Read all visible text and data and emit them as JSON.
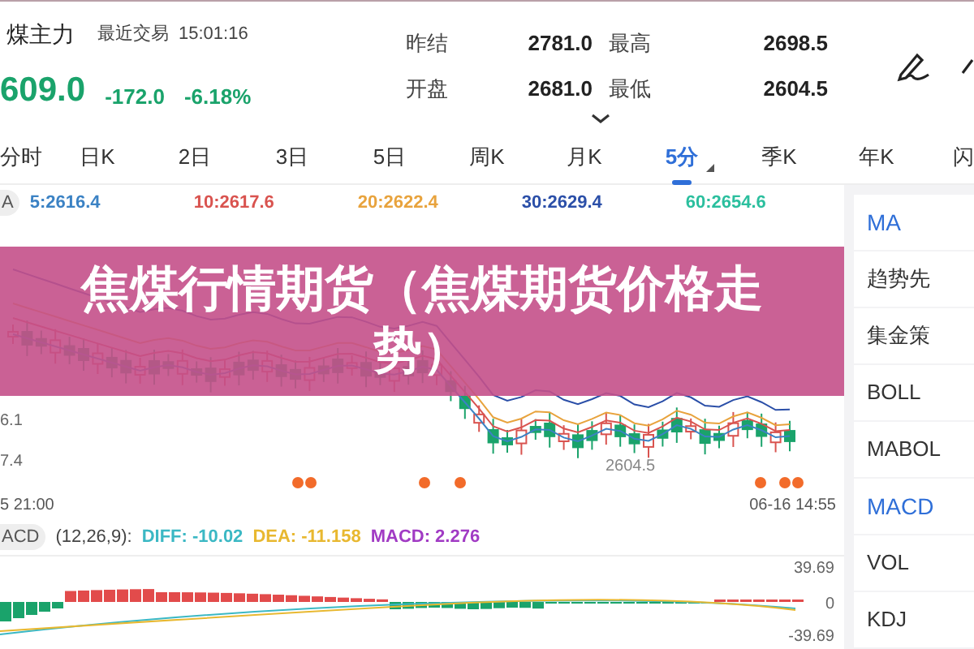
{
  "header": {
    "name": "煤主力",
    "trade_label": "最近交易",
    "trade_time": "15:01:16",
    "price": "609.0",
    "change": "-172.0",
    "change_pct": "-6.18%",
    "stats": [
      {
        "label": "昨结",
        "value": "2781.0"
      },
      {
        "label": "最高",
        "value": "2698.5"
      },
      {
        "label": "开盘",
        "value": "2681.0"
      },
      {
        "label": "最低",
        "value": "2604.5"
      }
    ]
  },
  "tabs": [
    {
      "label": "分时",
      "selected": false
    },
    {
      "label": "日K",
      "selected": false
    },
    {
      "label": "2日",
      "selected": false
    },
    {
      "label": "3日",
      "selected": false
    },
    {
      "label": "5日",
      "selected": false
    },
    {
      "label": "周K",
      "selected": false
    },
    {
      "label": "月K",
      "selected": false
    },
    {
      "label": "5分",
      "selected": true
    },
    {
      "label": "季K",
      "selected": false
    },
    {
      "label": "年K",
      "selected": false
    },
    {
      "label": "闪",
      "selected": false
    }
  ],
  "ma_legend": {
    "badge": "A",
    "items": [
      {
        "text": "5:2616.4",
        "color": "#3b82c4"
      },
      {
        "text": "10:2617.6",
        "color": "#d9534f"
      },
      {
        "text": "20:2622.4",
        "color": "#e8a33d"
      },
      {
        "text": "30:2629.4",
        "color": "#2b4fa8"
      },
      {
        "text": "60:2654.6",
        "color": "#2bbf9e"
      }
    ]
  },
  "main_chart": {
    "y_labels": [
      "6.1",
      "7.4"
    ],
    "low_label": "2604.5",
    "time_start": "5 21:00",
    "time_end": "06-16 14:55"
  },
  "macd_legend": {
    "badge": "ACD",
    "params": "(12,26,9):",
    "items": [
      {
        "text": "DIFF: -10.02",
        "color": "#3bb8c4"
      },
      {
        "text": "DEA: -11.158",
        "color": "#e8b830"
      },
      {
        "text": "MACD: 2.276",
        "color": "#a13bc4"
      }
    ]
  },
  "macd_chart": {
    "y_labels": [
      "39.69",
      "0",
      "-39.69"
    ]
  },
  "indicators": [
    {
      "label": "MA",
      "selected": true
    },
    {
      "label": "趋势先",
      "selected": false
    },
    {
      "label": "集金策",
      "selected": false
    },
    {
      "label": "BOLL",
      "selected": false
    },
    {
      "label": "MABOL",
      "selected": false
    },
    {
      "label": "MACD",
      "selected": true
    },
    {
      "label": "VOL",
      "selected": false
    },
    {
      "label": "KDJ",
      "selected": false
    }
  ],
  "banner": {
    "title": "焦煤行情期货（焦煤期货价格走势）"
  }
}
